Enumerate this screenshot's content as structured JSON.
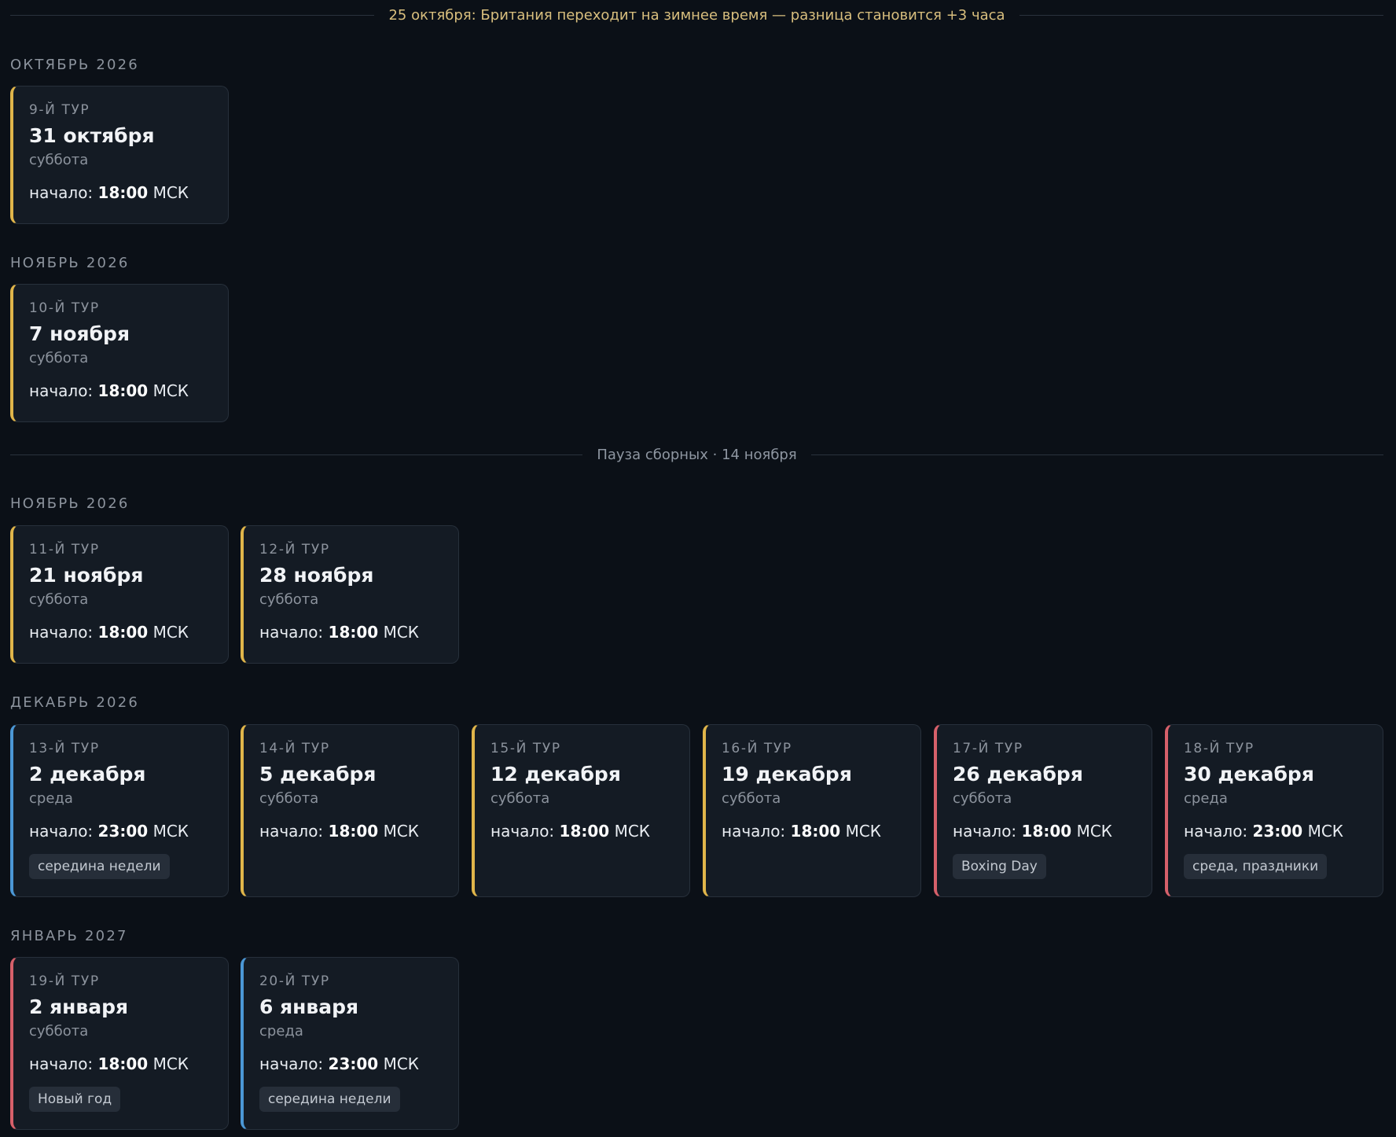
{
  "dst_notice": "25 октября: Британия переходит на зимнее время — разница становится +3 часа",
  "pause_notice": "Пауза сборных · 14 ноября",
  "start_prefix": "начало:",
  "timezone": "МСК",
  "colors": {
    "background": "#0b1017",
    "card": "#141b24",
    "weekend_accent": "#e0b54a",
    "midweek_accent": "#4b97d5",
    "holiday_accent": "#d6606a",
    "dst_text": "#d9bf7e"
  },
  "months": [
    {
      "label": "Октябрь 2026",
      "rounds": [
        {
          "round": "9-й тур",
          "date": "31 октября",
          "weekday": "суббота",
          "time": "18:00",
          "accent": "yellow",
          "tag": ""
        }
      ]
    },
    {
      "label": "Ноябрь 2026",
      "rounds": [
        {
          "round": "10-й тур",
          "date": "7 ноября",
          "weekday": "суббота",
          "time": "18:00",
          "accent": "yellow",
          "tag": ""
        }
      ]
    },
    {
      "label": "Ноябрь 2026",
      "rounds": [
        {
          "round": "11-й тур",
          "date": "21 ноября",
          "weekday": "суббота",
          "time": "18:00",
          "accent": "yellow",
          "tag": ""
        },
        {
          "round": "12-й тур",
          "date": "28 ноября",
          "weekday": "суббота",
          "time": "18:00",
          "accent": "yellow",
          "tag": ""
        }
      ]
    },
    {
      "label": "Декабрь 2026",
      "rounds": [
        {
          "round": "13-й тур",
          "date": "2 декабря",
          "weekday": "среда",
          "time": "23:00",
          "accent": "blue",
          "tag": "середина недели"
        },
        {
          "round": "14-й тур",
          "date": "5 декабря",
          "weekday": "суббота",
          "time": "18:00",
          "accent": "yellow",
          "tag": ""
        },
        {
          "round": "15-й тур",
          "date": "12 декабря",
          "weekday": "суббота",
          "time": "18:00",
          "accent": "yellow",
          "tag": ""
        },
        {
          "round": "16-й тур",
          "date": "19 декабря",
          "weekday": "суббота",
          "time": "18:00",
          "accent": "yellow",
          "tag": ""
        },
        {
          "round": "17-й тур",
          "date": "26 декабря",
          "weekday": "суббота",
          "time": "18:00",
          "accent": "red",
          "tag": "Boxing Day"
        },
        {
          "round": "18-й тур",
          "date": "30 декабря",
          "weekday": "среда",
          "time": "23:00",
          "accent": "red",
          "tag": "среда, праздники"
        }
      ]
    },
    {
      "label": "Январь 2027",
      "rounds": [
        {
          "round": "19-й тур",
          "date": "2 января",
          "weekday": "суббота",
          "time": "18:00",
          "accent": "red",
          "tag": "Новый год"
        },
        {
          "round": "20-й тур",
          "date": "6 января",
          "weekday": "среда",
          "time": "23:00",
          "accent": "blue",
          "tag": "середина недели"
        }
      ]
    }
  ]
}
